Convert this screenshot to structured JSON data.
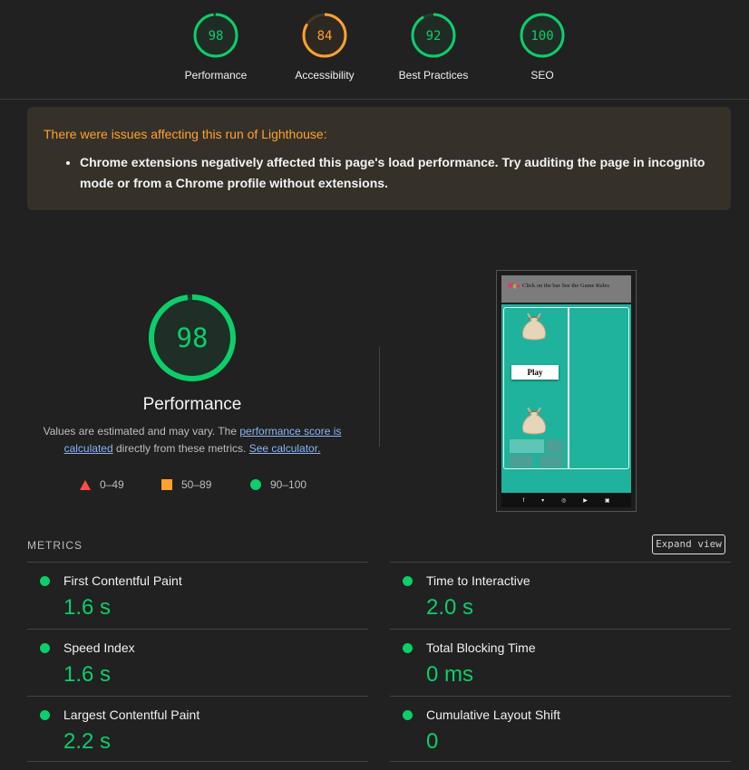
{
  "gauges": [
    {
      "label": "Performance",
      "score": "98",
      "color": "#0cce6b",
      "fraction": 0.98
    },
    {
      "label": "Accessibility",
      "score": "84",
      "color": "#ffa12f",
      "fraction": 0.84
    },
    {
      "label": "Best Practices",
      "score": "92",
      "color": "#0cce6b",
      "fraction": 0.92
    },
    {
      "label": "SEO",
      "score": "100",
      "color": "#0cce6b",
      "fraction": 1.0
    }
  ],
  "warning": {
    "title": "There were issues affecting this run of Lighthouse:",
    "items": [
      "Chrome extensions negatively affected this page's load performance. Try auditing the page in incognito mode or from a Chrome profile without extensions."
    ]
  },
  "performance": {
    "score": "98",
    "fraction": 0.98,
    "title": "Performance",
    "desc_prefix": "Values are estimated and may vary. The ",
    "desc_link1": "performance score is calculated",
    "desc_middle": " directly from these metrics. ",
    "desc_link2": "See calculator."
  },
  "legend": [
    {
      "range": "0–49",
      "shape": "triangle",
      "color": "#ff4e42"
    },
    {
      "range": "50–89",
      "shape": "square",
      "color": "#ffa12f"
    },
    {
      "range": "90–100",
      "shape": "circle",
      "color": "#0cce6b"
    }
  ],
  "screenshot": {
    "header_text": "Click on the bar See the Game Rules",
    "play_label": "Play",
    "footer_icons": [
      "f",
      "t",
      "ig",
      "yt",
      "in"
    ]
  },
  "metrics": {
    "section_label": "METRICS",
    "expand_label": "Expand view",
    "items": [
      {
        "name": "First Contentful Paint",
        "value": "1.6 s"
      },
      {
        "name": "Time to Interactive",
        "value": "2.0 s"
      },
      {
        "name": "Speed Index",
        "value": "1.6 s"
      },
      {
        "name": "Total Blocking Time",
        "value": "0 ms"
      },
      {
        "name": "Largest Contentful Paint",
        "value": "2.2 s"
      },
      {
        "name": "Cumulative Layout Shift",
        "value": "0"
      }
    ]
  }
}
